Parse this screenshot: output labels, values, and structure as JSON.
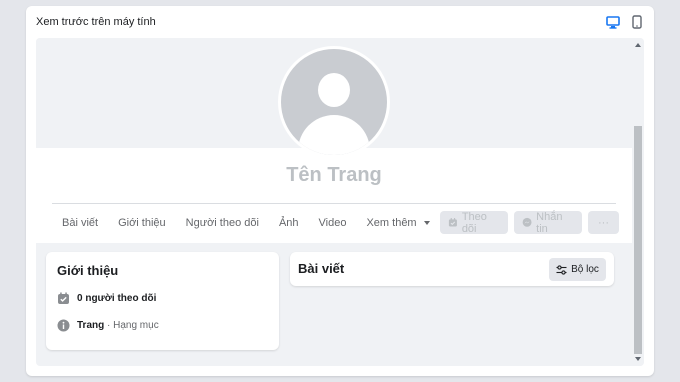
{
  "header": {
    "title": "Xem trước trên máy tính",
    "devices": [
      {
        "icon": "desktop-icon",
        "active": true
      },
      {
        "icon": "mobile-icon",
        "active": false
      }
    ]
  },
  "profile": {
    "page_name": "Tên Trang",
    "avatar_icon": "default-avatar-icon"
  },
  "tabs": [
    {
      "label": "Bài viết"
    },
    {
      "label": "Giới thiệu"
    },
    {
      "label": "Người theo dõi"
    },
    {
      "label": "Ảnh"
    },
    {
      "label": "Video"
    },
    {
      "label": "Xem thêm",
      "icon": "caret-down-icon"
    }
  ],
  "actions": {
    "follow_label": "Theo dõi",
    "message_label": "Nhắn tin",
    "more_label": "···"
  },
  "intro": {
    "title": "Giới thiệu",
    "followers_text": "0 người theo dõi",
    "category_bold": "Trang",
    "category_rest": " · Hạng mục"
  },
  "posts": {
    "title": "Bài viết",
    "filter_label": "Bộ lọc"
  },
  "colors": {
    "accent": "#1877f2",
    "disabled_text": "#bcc0c4",
    "button_bg": "#e4e6eb",
    "preview_bg": "#f0f2f5"
  }
}
